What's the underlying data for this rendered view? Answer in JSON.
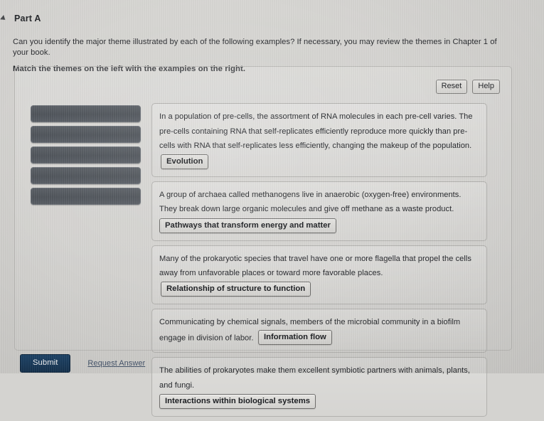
{
  "header": {
    "collapse_icon": "triangle-down-icon",
    "part_label": "Part A"
  },
  "instructions": {
    "line1": "Can you identify the major theme illustrated by each of the following examples? If necessary, you may review the themes in Chapter 1 of your book.",
    "line2": "Match the themes on the left with the examples on the right."
  },
  "toolbar": {
    "reset_label": "Reset",
    "help_label": "Help"
  },
  "drop_slots": [
    {
      "label": ""
    },
    {
      "label": ""
    },
    {
      "label": ""
    },
    {
      "label": ""
    },
    {
      "label": ""
    }
  ],
  "examples": [
    {
      "text": "In a population of pre-cells, the assortment of RNA molecules in each pre-cell varies. The pre-cells containing RNA that self-replicates efficiently reproduce more quickly than pre-cells with RNA that self-replicates less efficiently, changing the makeup of the population.",
      "answer": "Evolution",
      "answer_on_own_line": false
    },
    {
      "text": "A group of archaea called methanogens live in anaerobic (oxygen-free) environments. They break down large organic molecules and give off methane as a waste product.",
      "answer": "Pathways that transform energy and matter",
      "answer_on_own_line": true
    },
    {
      "text": "Many of the prokaryotic species that travel have one or more flagella that propel the cells away from unfavorable places or toward more favorable places.",
      "answer": "Relationship of structure to function",
      "answer_on_own_line": false
    },
    {
      "text": "Communicating by chemical signals, members of the microbial community in a biofilm engage in division of labor.",
      "answer": "Information flow",
      "answer_on_own_line": false
    },
    {
      "text": "The abilities of prokaryotes make them excellent symbiotic partners with animals, plants, and fungi.",
      "answer": "Interactions within biological systems",
      "answer_on_own_line": true
    }
  ],
  "footer": {
    "submit_label": "Submit",
    "request_answer_label": "Request Answer"
  },
  "colors": {
    "page_background": "#d4d3d0",
    "drop_slot": "#545960",
    "submit_button": "#1a3d5e",
    "link": "#44536a",
    "panel_border": "#bbbab7"
  }
}
